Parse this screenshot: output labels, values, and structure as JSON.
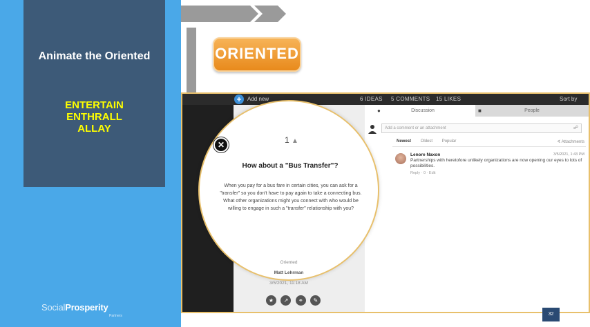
{
  "slide": {
    "title": "Animate the Oriented",
    "keywords": [
      "ENTERTAIN",
      "ENTHRALL",
      "ALLAY"
    ],
    "badge": "ORIENTED",
    "page_number": "32"
  },
  "brand": {
    "name_part1": "Social",
    "name_part2": "Prosperity",
    "tagline": "Partners"
  },
  "screenshot": {
    "topbar": {
      "add_label": "Add new",
      "ideas": "6 IDEAS",
      "comments": "5 COMMENTS",
      "likes": "15 LIKES",
      "sort": "Sort by"
    },
    "idea": {
      "likes": "1",
      "title": "How about a \"Bus Transfer\"?",
      "body": "When you pay for a bus fare in certain cities, you can ask for a \"transfer\" so you don't have to pay again to take a connecting bus. What other organizations might you connect with who would be willing to engage in such a \"transfer\" relationship with you?",
      "category": "Oriented",
      "author": "Matt Lehrman",
      "date": "3/5/2021, 11:18 AM"
    },
    "discussion": {
      "tab_discussion": "Discussion",
      "tab_people": "People",
      "input_placeholder": "Add a comment or an attachment",
      "sort_newest": "Newest",
      "sort_oldest": "Oldest",
      "sort_popular": "Popular",
      "attachments": "Attachments",
      "comment": {
        "author": "Lenore Naxon",
        "date": "3/5/2021, 1:43 PM",
        "text": "Partnerships with heretofore unlikely organizations are now opening our eyes to lots of possibilities.",
        "actions": "Reply · 0 · Edit"
      }
    }
  },
  "colors": {
    "left_panel": "#4aa8e8",
    "title_card": "#3d5a78",
    "keyword": "#ffff00",
    "badge": "#f0a040",
    "frame": "#e8c06c"
  }
}
